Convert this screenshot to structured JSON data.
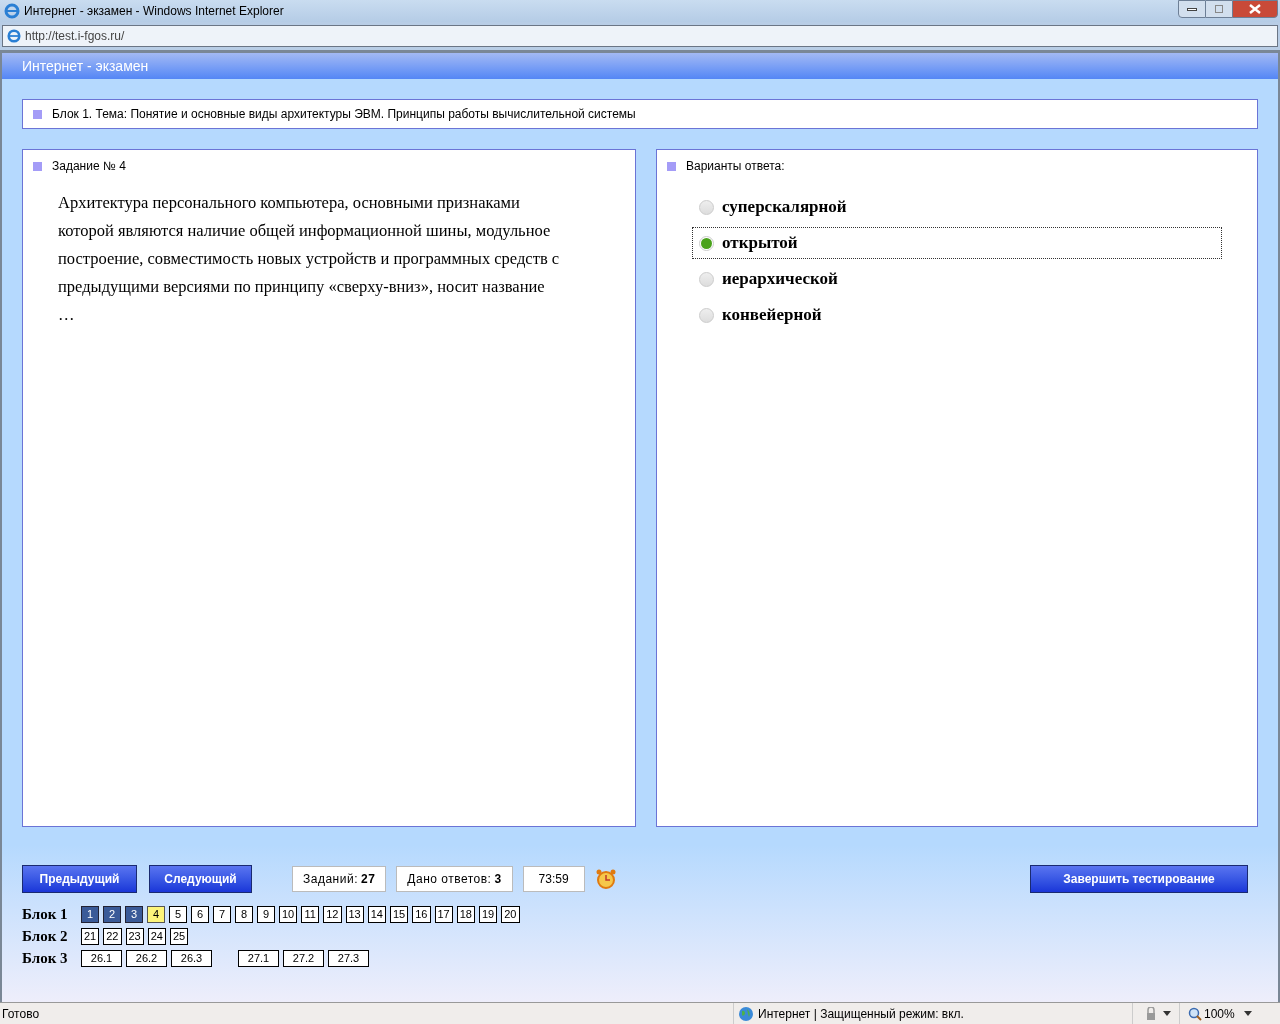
{
  "window": {
    "title": "Интернет - экзамен - Windows Internet Explorer"
  },
  "address_bar": {
    "value": "http://test.i-fgos.ru/"
  },
  "app_header": {
    "title": "Интернет - экзамен"
  },
  "block_topic": "Блок 1. Тема: Понятие и основные виды архитектуры ЭВМ. Принципы работы вычислительной системы",
  "question": {
    "title": "Задание № 4",
    "text": "Архитектура персонального компьютера, основными признаками которой являются наличие общей информационной шины, модульное построение, совместимость новых устройств и программных средств с предыдущими версиями по принципу «сверху-вниз», носит название …"
  },
  "answers": {
    "title": "Варианты ответа:",
    "options": [
      {
        "label": "суперскалярной",
        "selected": false
      },
      {
        "label": "открытой",
        "selected": true
      },
      {
        "label": "иерархической",
        "selected": false
      },
      {
        "label": "конвейерной",
        "selected": false
      }
    ]
  },
  "buttons": {
    "prev": "Предыдущий",
    "next": "Следующий",
    "finish": "Завершить тестирование"
  },
  "counters": [
    {
      "label": "Заданий: ",
      "value": "27"
    },
    {
      "label": "Дано ответов: ",
      "value": "3"
    }
  ],
  "timer": "73:59",
  "blocks": [
    {
      "label": "Блок 1",
      "groups": [
        [
          {
            "n": "1",
            "answered": true,
            "selected": false
          },
          {
            "n": "2",
            "answered": true,
            "selected": false
          },
          {
            "n": "3",
            "answered": true,
            "selected": false
          },
          {
            "n": "4",
            "answered": false,
            "selected": true
          },
          {
            "n": "5",
            "answered": false,
            "selected": false
          },
          {
            "n": "6",
            "answered": false,
            "selected": false
          },
          {
            "n": "7",
            "answered": false,
            "selected": false
          },
          {
            "n": "8",
            "answered": false,
            "selected": false
          },
          {
            "n": "9",
            "answered": false,
            "selected": false
          },
          {
            "n": "10",
            "answered": false,
            "selected": false
          },
          {
            "n": "11",
            "answered": false,
            "selected": false
          },
          {
            "n": "12",
            "answered": false,
            "selected": false
          },
          {
            "n": "13",
            "answered": false,
            "selected": false
          },
          {
            "n": "14",
            "answered": false,
            "selected": false
          },
          {
            "n": "15",
            "answered": false,
            "selected": false
          },
          {
            "n": "16",
            "answered": false,
            "selected": false
          },
          {
            "n": "17",
            "answered": false,
            "selected": false
          },
          {
            "n": "18",
            "answered": false,
            "selected": false
          },
          {
            "n": "19",
            "answered": false,
            "selected": false
          },
          {
            "n": "20",
            "answered": false,
            "selected": false
          }
        ]
      ]
    },
    {
      "label": "Блок 2",
      "groups": [
        [
          {
            "n": "21",
            "answered": false,
            "selected": false
          },
          {
            "n": "22",
            "answered": false,
            "selected": false
          },
          {
            "n": "23",
            "answered": false,
            "selected": false
          },
          {
            "n": "24",
            "answered": false,
            "selected": false
          },
          {
            "n": "25",
            "answered": false,
            "selected": false
          }
        ]
      ]
    },
    {
      "label": "Блок 3",
      "groups": [
        [
          {
            "n": "26.1",
            "answered": false,
            "selected": false
          },
          {
            "n": "26.2",
            "answered": false,
            "selected": false
          },
          {
            "n": "26.3",
            "answered": false,
            "selected": false
          }
        ],
        [
          {
            "n": "27.1",
            "answered": false,
            "selected": false
          },
          {
            "n": "27.2",
            "answered": false,
            "selected": false
          },
          {
            "n": "27.3",
            "answered": false,
            "selected": false
          }
        ]
      ]
    }
  ],
  "status_bar": {
    "text": "Готово",
    "zone": "Интернет | Защищенный режим: вкл.",
    "zoom": "100%"
  }
}
